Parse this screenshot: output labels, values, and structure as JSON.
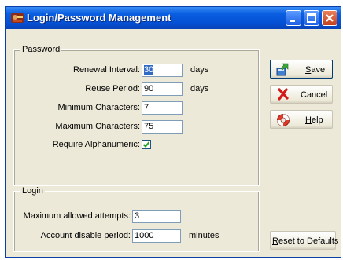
{
  "window": {
    "title": "Login/Password Management"
  },
  "password_group": {
    "title": "Password",
    "renewal_interval": {
      "label": "Renewal Interval:",
      "value": "30",
      "unit": "days"
    },
    "reuse_period": {
      "label": "Reuse Period:",
      "value": "90",
      "unit": "days"
    },
    "min_chars": {
      "label": "Minimum Characters:",
      "value": "7"
    },
    "max_chars": {
      "label": "Maximum Characters:",
      "value": "75"
    },
    "require_alnum": {
      "label": "Require Alphanumeric:",
      "checked": true
    }
  },
  "login_group": {
    "title": "Login",
    "max_attempts": {
      "label": "Maximum allowed attempts:",
      "value": "3"
    },
    "disable_period": {
      "label": "Account disable period:",
      "value": "1000",
      "unit": "minutes"
    }
  },
  "buttons": {
    "save": {
      "accel": "S",
      "rest": "ave"
    },
    "cancel": {
      "label": "Cancel"
    },
    "help": {
      "accel": "H",
      "rest": "elp"
    },
    "reset": {
      "accel": "R",
      "rest": "eset to Defaults"
    }
  },
  "icons": {
    "app": "app-icon",
    "save": "save-icon",
    "cancel": "cancel-x-icon",
    "help": "help-lifebuoy-icon"
  }
}
